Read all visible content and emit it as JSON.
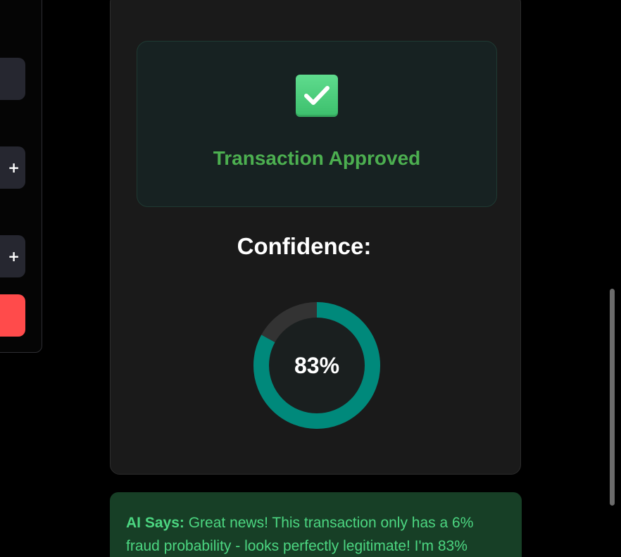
{
  "sidebar_form": {
    "increment_label": "+",
    "increment_label_2": "+"
  },
  "result": {
    "status_icon": "check-mark-button-icon",
    "status_text": "Transaction Approved",
    "status_color": "#4caf50",
    "confidence_label": "Confidence:",
    "confidence_value": 83,
    "confidence_text": "83%",
    "gauge_color": "#00897b"
  },
  "ai_message": {
    "prefix": "AI Says:",
    "text": "Great news! This transaction only has a 6% fraud probability - looks perfectly legitimate! I'm 83%"
  }
}
